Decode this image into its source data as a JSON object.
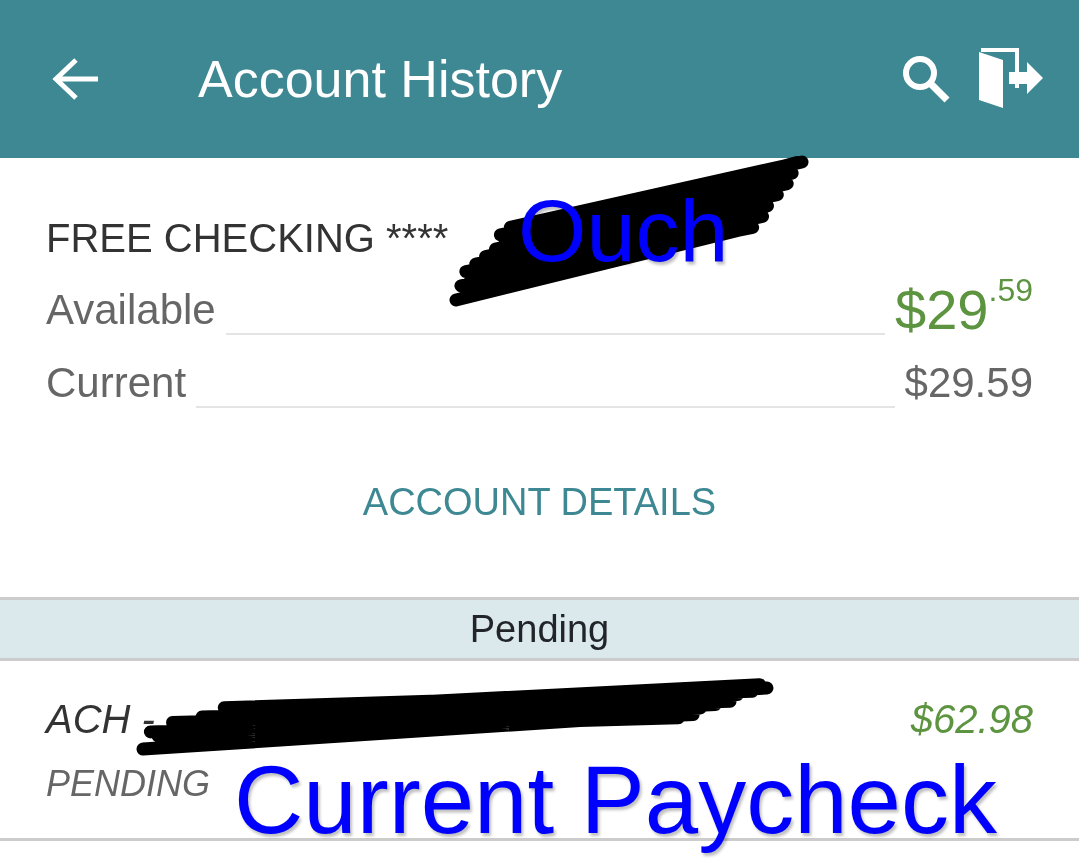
{
  "app_bar": {
    "title": "Account History"
  },
  "account": {
    "name": "FREE CHECKING ****",
    "balances": [
      {
        "label": "Available",
        "amount": "$29$^{.59}$",
        "kind": "primary"
      },
      {
        "label": "Current",
        "amount": "$29.59",
        "kind": "secondary"
      }
    ],
    "details_button": "ACCOUNT DETAILS"
  },
  "section_header": "Pending",
  "transactions": [
    {
      "description": "ACH -",
      "amount": "$62.98",
      "status": "PENDING"
    }
  ],
  "annotations": [
    {
      "text": "Ouch"
    },
    {
      "text": "Current Paycheck"
    }
  ]
}
